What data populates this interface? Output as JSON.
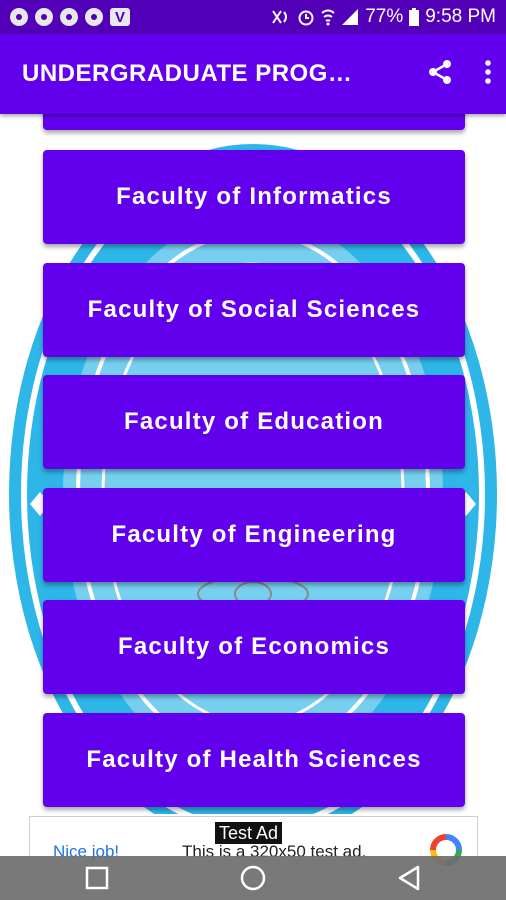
{
  "status_bar": {
    "battery": "77%",
    "time": "9:58 PM",
    "notification_icons": [
      "notification-icon",
      "notification-icon",
      "notification-icon",
      "notification-icon",
      "v-app-icon"
    ]
  },
  "app_bar": {
    "title": "UNDERGRADUATE PROG…",
    "share_icon": "share-icon",
    "menu_icon": "more-vert-icon"
  },
  "faculties": [
    "Faculty of Informatics",
    "Faculty of Social Sciences",
    "Faculty of Education",
    "Faculty of Engineering",
    "Faculty of Economics",
    "Faculty of Health Sciences"
  ],
  "ad": {
    "tag": "Test Ad",
    "nice": "Nice job!",
    "text": "This is a 320x50 test ad."
  },
  "colors": {
    "primary": "#6200ee",
    "status_bar": "#5200b8",
    "logo_blue": "#2eb6e8"
  }
}
